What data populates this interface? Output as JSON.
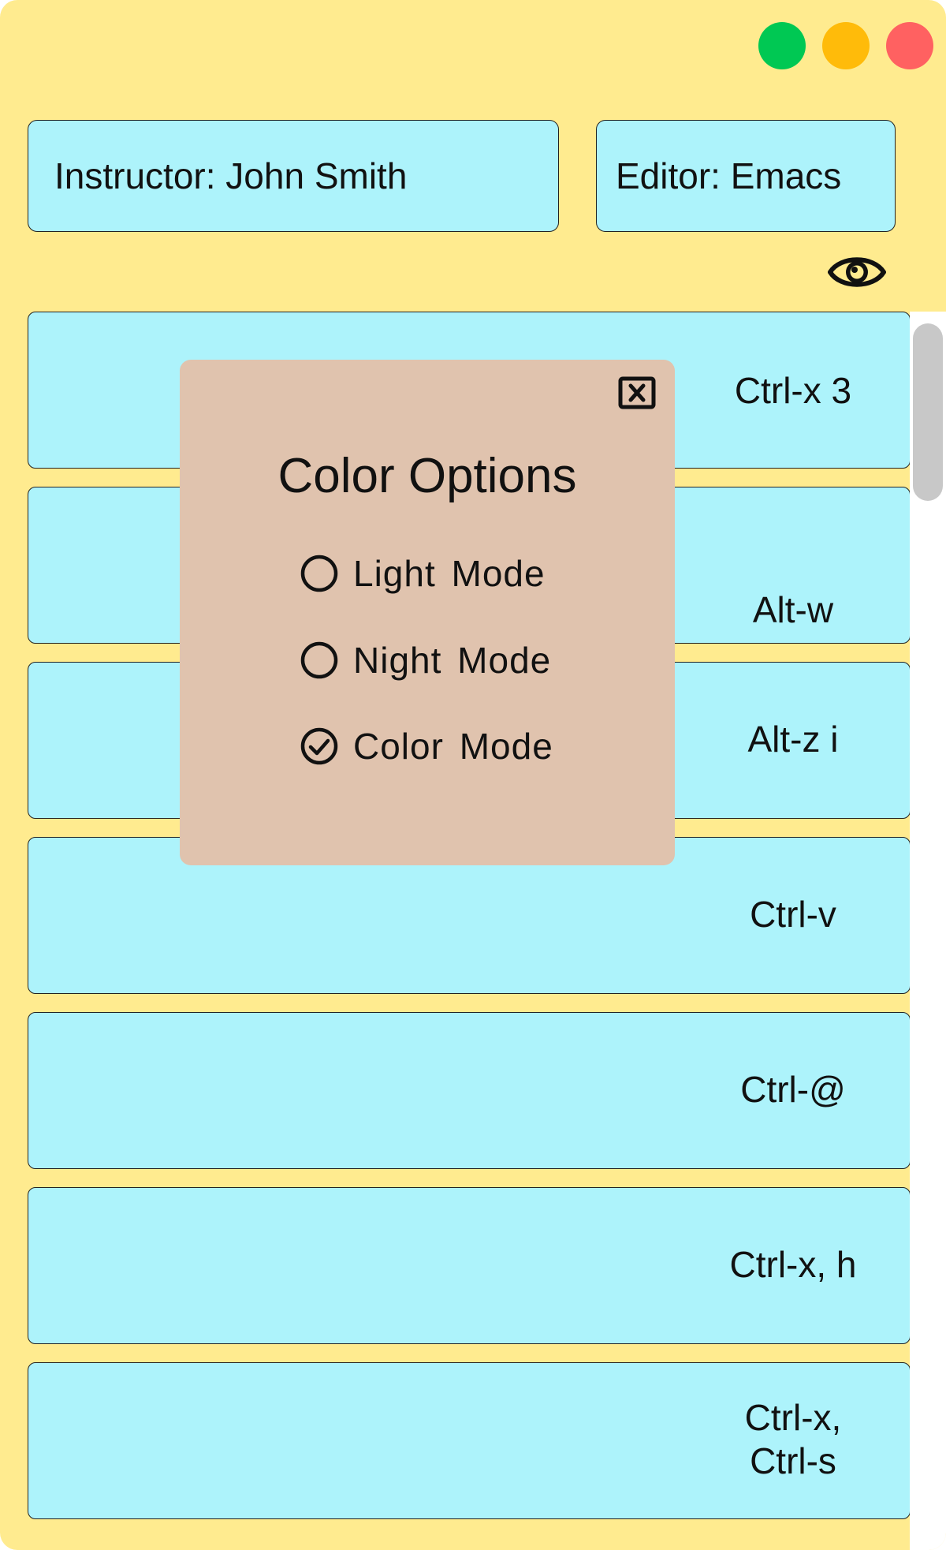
{
  "window": {
    "controls": [
      "maximize-icon",
      "minimize-icon",
      "close-icon"
    ],
    "colors": {
      "background": "#ffeb8f",
      "card": "#adf3fb",
      "modal": "#e0c3ae"
    }
  },
  "header": {
    "instructor": "Instructor: John Smith",
    "editor": "Editor: Emacs",
    "visibility_icon": "eye-icon"
  },
  "shortcuts": [
    "Ctrl-x 3",
    "Alt-w",
    "Alt-z i",
    "Ctrl-v",
    "Ctrl-@",
    "Ctrl-x, h",
    "Ctrl-x,\nCtrl-s"
  ],
  "modal": {
    "title": "Color Options",
    "close_icon": "close-box-icon",
    "options": [
      {
        "label": "Light Mode",
        "selected": false
      },
      {
        "label": "Night Mode",
        "selected": false
      },
      {
        "label": "Color Mode",
        "selected": true
      }
    ]
  }
}
